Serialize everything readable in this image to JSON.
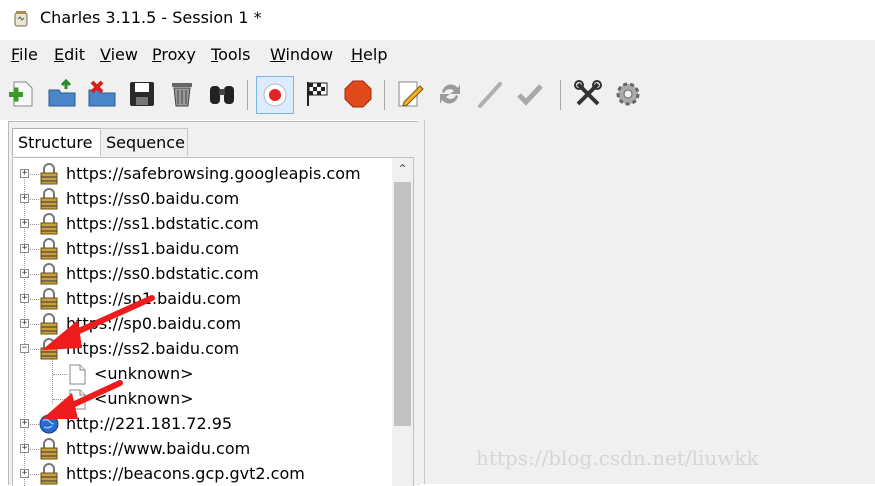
{
  "window": {
    "title": "Charles 3.11.5 - Session 1 *",
    "icon": "charles-jar-icon"
  },
  "menu": [
    "File",
    "Edit",
    "View",
    "Proxy",
    "Tools",
    "Window",
    "Help"
  ],
  "toolbar": [
    {
      "icon": "new-session-icon"
    },
    {
      "icon": "open-session-icon"
    },
    {
      "icon": "close-session-icon"
    },
    {
      "icon": "save-icon"
    },
    {
      "icon": "clear-trash-icon"
    },
    {
      "icon": "find-binoculars-icon"
    },
    {
      "icon": "record-icon",
      "active": true
    },
    {
      "icon": "throttle-flag-icon"
    },
    {
      "icon": "breakpoints-stop-icon"
    },
    {
      "icon": "compose-pencil-icon"
    },
    {
      "icon": "repeat-icon"
    },
    {
      "icon": "edit-pen-icon"
    },
    {
      "icon": "validate-check-icon"
    },
    {
      "icon": "tools-icon"
    },
    {
      "icon": "settings-gear-icon"
    }
  ],
  "tabs": [
    {
      "label": "Structure",
      "selected": true
    },
    {
      "label": "Sequence",
      "selected": false
    }
  ],
  "tree": [
    {
      "label": "https://safebrowsing.googleapis.com",
      "type": "https",
      "expanded": false,
      "depth": 0
    },
    {
      "label": "https://ss0.baidu.com",
      "type": "https",
      "expanded": false,
      "depth": 0
    },
    {
      "label": "https://ss1.bdstatic.com",
      "type": "https",
      "expanded": false,
      "depth": 0
    },
    {
      "label": "https://ss1.baidu.com",
      "type": "https",
      "expanded": false,
      "depth": 0
    },
    {
      "label": "https://ss0.bdstatic.com",
      "type": "https",
      "expanded": false,
      "depth": 0
    },
    {
      "label": "https://sp1.baidu.com",
      "type": "https",
      "expanded": false,
      "depth": 0
    },
    {
      "label": "https://sp0.baidu.com",
      "type": "https",
      "expanded": false,
      "depth": 0
    },
    {
      "label": "https://ss2.baidu.com",
      "type": "https",
      "expanded": true,
      "depth": 0
    },
    {
      "label": "<unknown>",
      "type": "file",
      "depth": 1
    },
    {
      "label": "<unknown>",
      "type": "file",
      "depth": 1
    },
    {
      "label": "http://221.181.72.95",
      "type": "http",
      "expanded": false,
      "depth": 0
    },
    {
      "label": "https://www.baidu.com",
      "type": "https",
      "expanded": false,
      "depth": 0
    },
    {
      "label": "https://beacons.gcp.gvt2.com",
      "type": "https",
      "expanded": false,
      "depth": 0
    }
  ],
  "colors": {
    "annotation_arrow": "#ee1c1c",
    "record_active": "#e8202a"
  },
  "watermark": "https://blog.csdn.net/liuwkk"
}
